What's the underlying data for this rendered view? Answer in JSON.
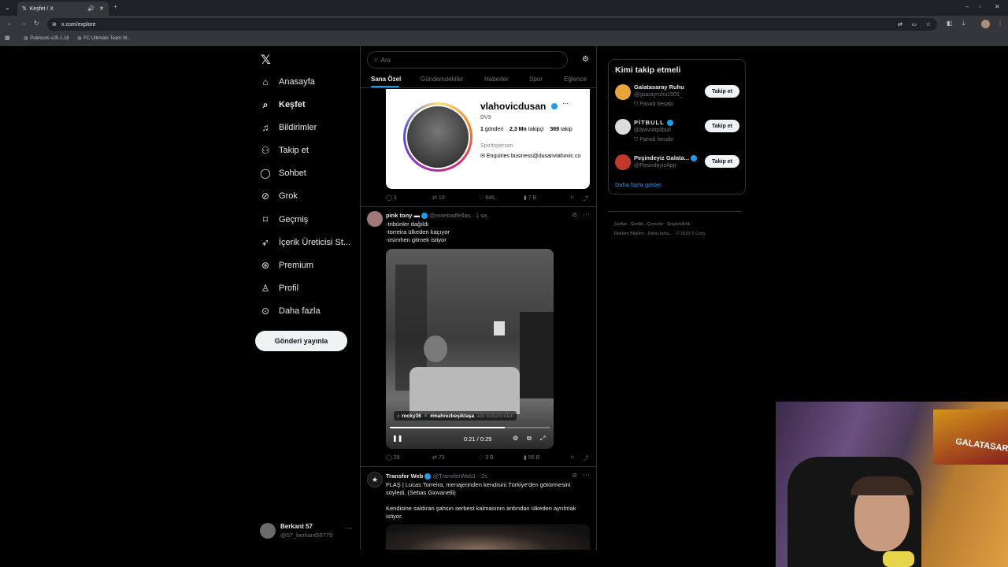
{
  "browser": {
    "tab_title": "Keşfet / X",
    "url": "x.com/explore",
    "bookmarks": [
      "Paletools v25.1.18",
      "FC Ultimate Team W..."
    ]
  },
  "nav": {
    "items": [
      {
        "icon": "home-icon",
        "label": "Anasayfa"
      },
      {
        "icon": "search-icon",
        "label": "Keşfet"
      },
      {
        "icon": "bell-icon",
        "label": "Bildirimler"
      },
      {
        "icon": "add-user-icon",
        "label": "Takip et"
      },
      {
        "icon": "chat-icon",
        "label": "Sohbet"
      },
      {
        "icon": "grok-icon",
        "label": "Grok"
      },
      {
        "icon": "bookmark-icon",
        "label": "Geçmiş"
      },
      {
        "icon": "rocket-icon",
        "label": "İçerik Üreticisi St..."
      },
      {
        "icon": "premium-icon",
        "label": "Premium"
      },
      {
        "icon": "profile-icon",
        "label": "Profil"
      },
      {
        "icon": "more-icon",
        "label": "Daha fazla"
      }
    ],
    "post_button": "Gönderi yayınla",
    "account": {
      "name": "Berkant 57",
      "handle": "@57_berkant55779"
    }
  },
  "search": {
    "placeholder": "Ara"
  },
  "tabs": [
    "Sana Özel",
    "Gündemdekiler",
    "Haberler",
    "Spor",
    "Eğlence"
  ],
  "profile_card": {
    "name": "vlahovicdusan",
    "sub": "DV9",
    "posts": "1",
    "posts_label": "gönderi",
    "followers": "2,3 Mn",
    "followers_label": "takipçi",
    "following": "369",
    "following_label": "takip",
    "category": "Sportsperson",
    "contact": "Enquiries business@dusanvlahovic.co"
  },
  "tweet1_stats": {
    "replies": "3",
    "reposts": "10",
    "likes": "646",
    "views": "7 B"
  },
  "tweet2": {
    "name": "pink tony",
    "handle": "@notebadfellas",
    "time": "1 sa",
    "lines": [
      "-tribünler dağıldı",
      "-torreira ülkeden kaçıyor",
      "-osimhen gitmek istiyor"
    ],
    "video_caption_user": "rocky36",
    "video_caption_tag": "#mahrezbeşiktaşa",
    "video_caption_suffix": "adlı kullanıcıdan",
    "video_time": "0:21 / 0:29",
    "video_progress": 0.72,
    "stats": {
      "replies": "39",
      "reposts": "73",
      "likes": "2 B",
      "views": "56 B"
    }
  },
  "tweet3": {
    "name": "Transfer Web",
    "handle": "@TransferWeb1",
    "time": "2s",
    "line1": "FLAŞ | Lucas Torreira, menajerinden kendisini Türkiye'den götürmesini söyledi. (Sebas Giovanelli)",
    "line2": "Kendisine saldıran şahsın serbest kalmasının ardından ülkeden ayrılmak istiyor."
  },
  "who_to_follow": {
    "title": "Kimi takip etmeli",
    "follow_label": "Takip et",
    "show_more": "Daha fazla göster",
    "accounts": [
      {
        "name": "Galatasaray Ruhu",
        "handle": "@gsarayruhu1905_",
        "note": "Parodi hesabı"
      },
      {
        "name": "PİTBULL",
        "handle": "@atavratpitbull",
        "note": "Parodi hesabı"
      },
      {
        "name": "Peşindeyiz Galata...",
        "handle": "@PesindeyizApp",
        "note": ""
      }
    ]
  },
  "footer_links": [
    "Şartlar",
    "Gizlilik",
    "Çerezler",
    "Erişilebilirlik",
    "Reklam Bilgileri",
    "Daha fazla...",
    "© 2025 X Corp."
  ],
  "webcam": {
    "banner_text": "GALATASARA"
  }
}
